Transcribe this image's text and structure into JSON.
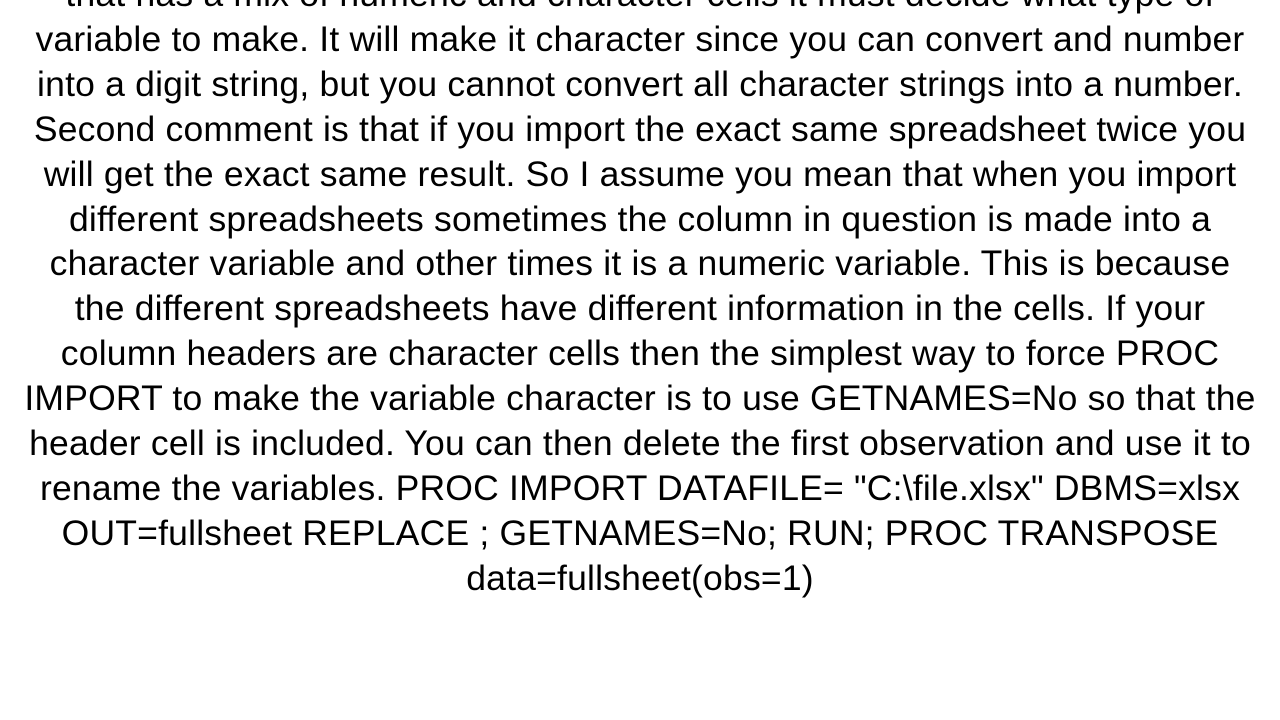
{
  "document": {
    "bodyText": "that has a mix of numeric and character cells it must decide what type of variable to make.  It will make it character since you can convert and number into a digit string, but you cannot convert all character strings into a number. Second comment is that if you import the exact same spreadsheet twice you will get the exact same result.  So I assume you mean that when you import different spreadsheets sometimes the column in question is made into a character variable and other times it is a numeric variable.  This is because the different spreadsheets have different information in the cells. If your column headers are character cells then the simplest way to force PROC IMPORT to make the variable character is to use GETNAMES=No so that the header cell is included.  You can then delete the first observation and use it to rename the variables. PROC IMPORT DATAFILE= \"C:\\file.xlsx\" DBMS=xlsx    OUT=fullsheet REPLACE ;    GETNAMES=No; RUN;  PROC TRANSPOSE data=fullsheet(obs=1)"
  }
}
